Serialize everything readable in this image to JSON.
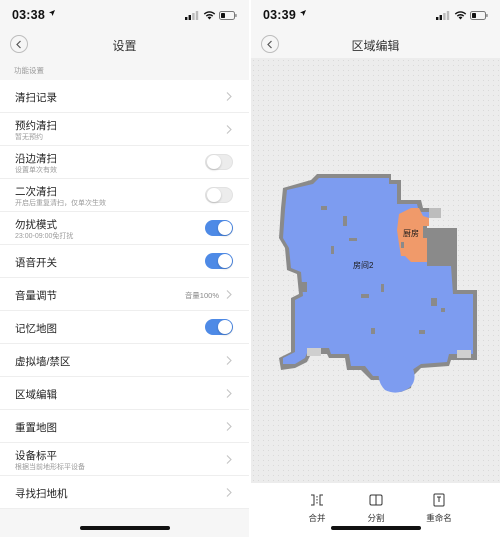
{
  "left": {
    "status": {
      "time": "03:38"
    },
    "nav": {
      "title": "设置"
    },
    "section_label": "功能设置",
    "rows": [
      {
        "label": "清扫记录",
        "control": "chevron"
      },
      {
        "label": "预约清扫",
        "sub": "暂无预约",
        "control": "chevron"
      },
      {
        "label": "沿边清扫",
        "sub": "设置单次有效",
        "control": "toggle",
        "on": false
      },
      {
        "label": "二次清扫",
        "sub": "开启后重复清扫，仅单次生效",
        "control": "toggle",
        "on": false
      },
      {
        "label": "勿扰模式",
        "sub": "23:00-09:00免打扰",
        "control": "toggle",
        "on": true
      },
      {
        "label": "语音开关",
        "control": "toggle",
        "on": true
      },
      {
        "label": "音量调节",
        "value": "音量100%",
        "control": "chevron"
      },
      {
        "label": "记忆地图",
        "control": "toggle",
        "on": true
      },
      {
        "label": "虚拟墙/禁区",
        "control": "chevron"
      },
      {
        "label": "区域编辑",
        "control": "chevron"
      },
      {
        "label": "重置地图",
        "control": "chevron"
      },
      {
        "label": "设备标平",
        "sub": "根据当前地形标平设备",
        "control": "chevron"
      },
      {
        "label": "寻找扫地机",
        "control": "chevron"
      }
    ]
  },
  "right": {
    "status": {
      "time": "03:39"
    },
    "nav": {
      "title": "区域编辑"
    },
    "rooms": [
      {
        "name": "房间2",
        "color": "#7d9cf0"
      },
      {
        "name": "厨房",
        "color": "#f09a6a"
      }
    ],
    "tools": [
      {
        "label": "合并",
        "icon": "merge-icon"
      },
      {
        "label": "分割",
        "icon": "split-icon"
      },
      {
        "label": "重命名",
        "icon": "rename-icon"
      }
    ]
  },
  "colors": {
    "accent": "#4e8ae6",
    "room_blue": "#7d9cf0",
    "room_orange": "#f09a6a",
    "wall": "#8a8a8a"
  }
}
